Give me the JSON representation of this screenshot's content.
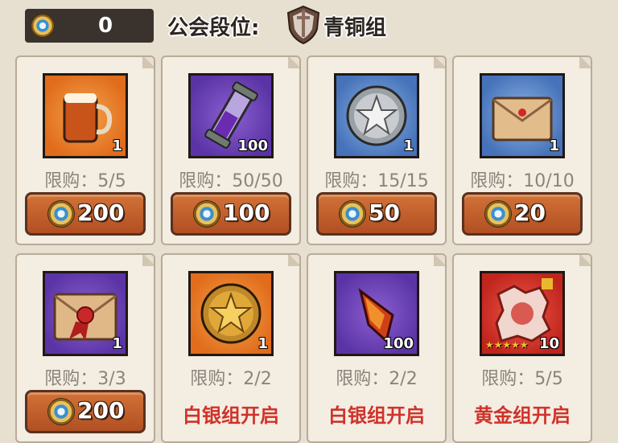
{
  "header": {
    "currency_icon": "guild-coin-icon",
    "currency_value": "0",
    "rank_label": "公会段位:",
    "rank_icon": "shield-sword-emblem-icon",
    "rank_value": "青铜组"
  },
  "items": [
    {
      "name": "beer-mug",
      "icon": "beer-mug-icon",
      "background": "#e07a2a",
      "qty": "1",
      "limit": "限购：5/5",
      "price": "200",
      "price_icon": "guild-coin-icon"
    },
    {
      "name": "purple-vial",
      "icon": "purple-vial-icon",
      "background": "#6a40b8",
      "qty": "100",
      "limit": "限购：50/50",
      "price": "100",
      "price_icon": "guild-coin-icon"
    },
    {
      "name": "silver-star-medal",
      "icon": "silver-star-medal-icon",
      "background": "#5a86c8",
      "qty": "1",
      "limit": "限购：15/15",
      "price": "50",
      "price_icon": "guild-coin-icon"
    },
    {
      "name": "sealed-envelope",
      "icon": "sealed-envelope-icon",
      "background": "#5a86c8",
      "qty": "1",
      "limit": "限购：10/10",
      "price": "20",
      "price_icon": "guild-coin-icon"
    },
    {
      "name": "ribbon-envelope",
      "icon": "ribbon-envelope-icon",
      "background": "#6a40b8",
      "qty": "1",
      "limit": "限购：3/3",
      "price": "200",
      "price_icon": "guild-coin-icon"
    },
    {
      "name": "gold-star-medal",
      "icon": "gold-star-medal-icon",
      "background": "#e07a2a",
      "qty": "1",
      "limit": "限购：2/2",
      "unlock": "白银组开启"
    },
    {
      "name": "fire-crystal",
      "icon": "fire-crystal-icon",
      "background": "#6a40b8",
      "qty": "100",
      "limit": "限购：2/2",
      "unlock": "白银组开启"
    },
    {
      "name": "hero-fragment",
      "icon": "hero-fragment-icon",
      "background": "#c8302a",
      "qty": "10",
      "stars": "★★★★★",
      "limit": "限购：5/5",
      "unlock": "黄金组开启"
    }
  ]
}
